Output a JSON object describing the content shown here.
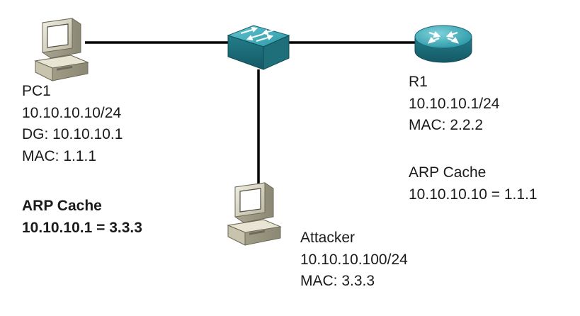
{
  "devices": {
    "pc1": {
      "name": "PC1",
      "ip": "10.10.10.10/24",
      "gateway": "DG: 10.10.10.1",
      "mac": "MAC: 1.1.1",
      "arp_cache_title": "ARP Cache",
      "arp_cache_entry": "10.10.10.1 = 3.3.3"
    },
    "r1": {
      "name": "R1",
      "ip": "10.10.10.1/24",
      "mac": "MAC: 2.2.2",
      "arp_cache_title": "ARP Cache",
      "arp_cache_entry": "10.10.10.10 = 1.1.1"
    },
    "attacker": {
      "name": "Attacker",
      "ip": "10.10.10.100/24",
      "mac": "MAC: 3.3.3"
    },
    "switch": {}
  },
  "colors": {
    "link": "#000000",
    "device_teal": "#2a8a99",
    "pc_beige": "#d9d6c4"
  },
  "icons": {
    "pc1": "workstation-icon",
    "attacker": "workstation-icon",
    "switch": "switch-icon",
    "r1": "router-icon"
  }
}
